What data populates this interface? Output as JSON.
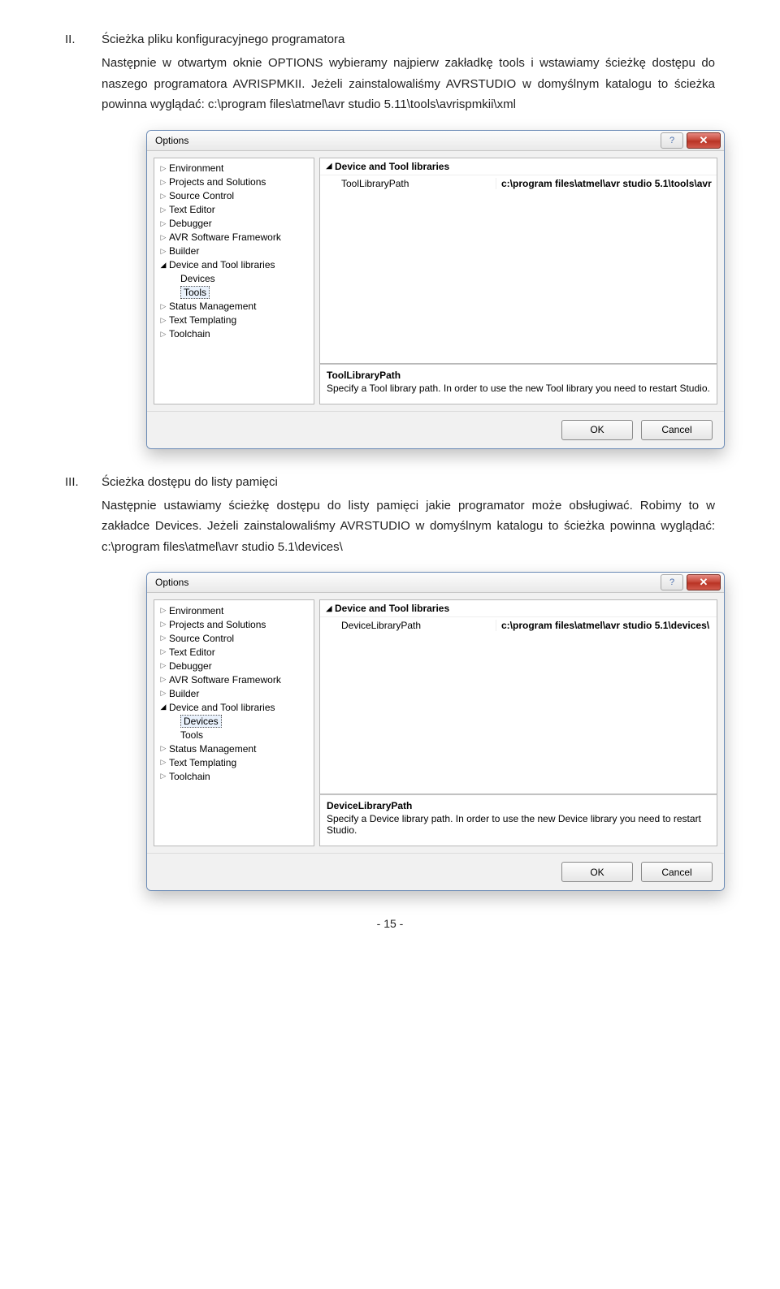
{
  "sec2": {
    "roman": "II.",
    "title": "Ścieżka pliku konfiguracyjnego programatora",
    "para": "Następnie w otwartym oknie OPTIONS wybieramy najpierw zakładkę tools i wstawiamy ścieżkę dostępu do naszego programatora AVRISPMKII. Jeżeli zainstalowaliśmy AVRSTUDIO w domyślnym katalogu to ścieżka powinna wyglądać: c:\\program files\\atmel\\avr studio 5.11\\tools\\avrispmkii\\xml"
  },
  "sec3": {
    "roman": "III.",
    "title": "Ścieżka dostępu do listy pamięci",
    "para": "Następnie ustawiamy ścieżkę dostępu do listy pamięci jakie programator może obsługiwać. Robimy to w zakładce Devices. Jeżeli zainstalowaliśmy AVRSTUDIO w domyślnym katalogu to ścieżka powinna wyglądać: c:\\program files\\atmel\\avr studio 5.1\\devices\\"
  },
  "dlg": {
    "title": "Options",
    "help": "?",
    "close": "✕",
    "ok": "OK",
    "cancel": "Cancel",
    "tree": {
      "environment": "Environment",
      "projects": "Projects and Solutions",
      "source": "Source Control",
      "texteditor": "Text Editor",
      "debugger": "Debugger",
      "avrfw": "AVR Software Framework",
      "builder": "Builder",
      "devtool": "Device and Tool libraries",
      "devices": "Devices",
      "tools": "Tools",
      "status": "Status Management",
      "templating": "Text Templating",
      "toolchain": "Toolchain"
    }
  },
  "dlg1": {
    "prop_cat": "Device and Tool libraries",
    "prop_key": "ToolLibraryPath",
    "prop_val": "c:\\program files\\atmel\\avr studio 5.1\\tools\\avr",
    "desc_title": "ToolLibraryPath",
    "desc_text": "Specify a Tool library path. In order to use the new Tool library you need to restart Studio."
  },
  "dlg2": {
    "prop_cat": "Device and Tool libraries",
    "prop_key": "DeviceLibraryPath",
    "prop_val": "c:\\program files\\atmel\\avr studio 5.1\\devices\\",
    "desc_title": "DeviceLibraryPath",
    "desc_text": "Specify a Device library path. In order to use the new Device library you need to restart Studio."
  },
  "pagenum": "- 15 -"
}
